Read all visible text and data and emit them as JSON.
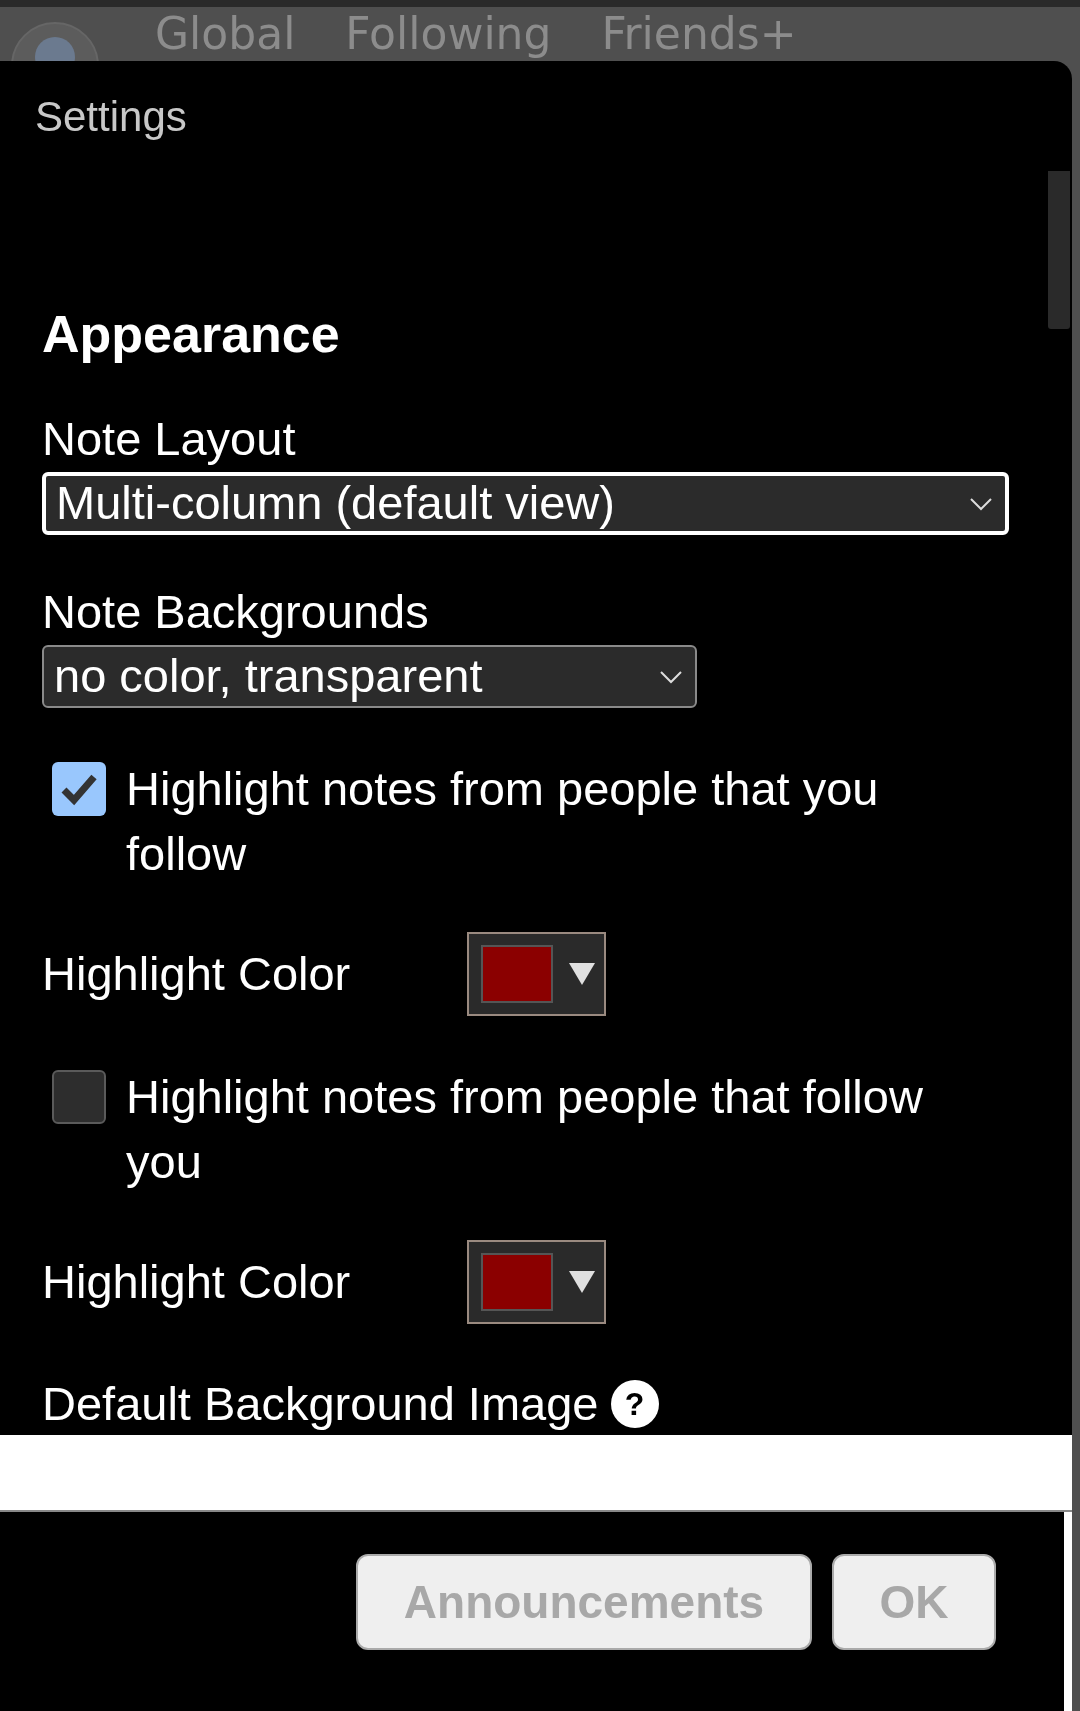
{
  "top_tabs": [
    {
      "label": "Global"
    },
    {
      "label": "Following"
    },
    {
      "label": "Friends+"
    }
  ],
  "dialog": {
    "title": "Settings",
    "section": "Appearance",
    "settings": [
      {
        "kind": "select",
        "label": "Note Layout",
        "value": "Multi-column (default view)",
        "focused": true
      },
      {
        "kind": "select",
        "label": "Note Backgrounds",
        "value": "no color, transparent",
        "focused": false
      },
      {
        "kind": "checkbox",
        "label": "Highlight notes from people that you follow",
        "checked": true
      },
      {
        "kind": "color",
        "label": "Highlight Color",
        "color": "#8b0000"
      },
      {
        "kind": "checkbox",
        "label": "Highlight notes from people that follow you",
        "checked": false
      },
      {
        "kind": "color",
        "label": "Highlight Color",
        "color": "#8b0000"
      },
      {
        "kind": "help",
        "label": "Default Background Image",
        "icon": "?"
      }
    ],
    "buttons": [
      {
        "label": "Announcements"
      },
      {
        "label": "OK"
      }
    ]
  }
}
